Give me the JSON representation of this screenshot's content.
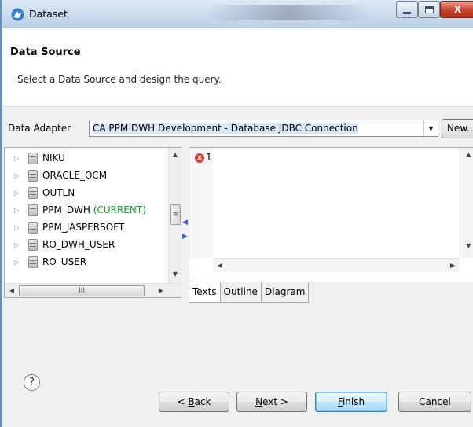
{
  "window": {
    "title": "Dataset",
    "controls": {
      "minimize": "minimize",
      "maximize": "maximize",
      "close": "X"
    }
  },
  "header": {
    "heading": "Data Source",
    "description": "Select a Data Source and design the query."
  },
  "adapter": {
    "label": "Data Adapter",
    "selected": "CA PPM DWH Development - Database JDBC Connection",
    "new_button": "New..."
  },
  "tree": {
    "items": [
      {
        "name": "NIKU",
        "suffix": ""
      },
      {
        "name": "ORACLE_OCM",
        "suffix": ""
      },
      {
        "name": "OUTLN",
        "suffix": ""
      },
      {
        "name": "PPM_DWH",
        "suffix": " (CURRENT)"
      },
      {
        "name": "PPM_JASPERSOFT",
        "suffix": ""
      },
      {
        "name": "RO_DWH_USER",
        "suffix": ""
      },
      {
        "name": "RO_USER",
        "suffix": ""
      }
    ],
    "scroll_thumb_grip": "≡",
    "hscroll_thumb_grip": "III"
  },
  "editor": {
    "line_number": "1",
    "error_icon": "x",
    "content": ""
  },
  "tabs": [
    {
      "label": "Texts",
      "active": true
    },
    {
      "label": "Outline",
      "active": false
    },
    {
      "label": "Diagram",
      "active": false
    }
  ],
  "footer": {
    "help": "?",
    "back_prefix": "< ",
    "back_mnemonic": "B",
    "back_rest": "ack",
    "next_mnemonic": "N",
    "next_rest": "ext >",
    "finish_mnemonic": "F",
    "finish_rest": "inish",
    "cancel": "Cancel"
  },
  "colors": {
    "current_schema": "#1f9a2e",
    "finish_default": "#3c7fb1",
    "error": "#d8463a"
  },
  "icons": {
    "app": "dataset-icon",
    "tree_item": "database-schema-icon",
    "expander": "triangle-right-icon"
  }
}
